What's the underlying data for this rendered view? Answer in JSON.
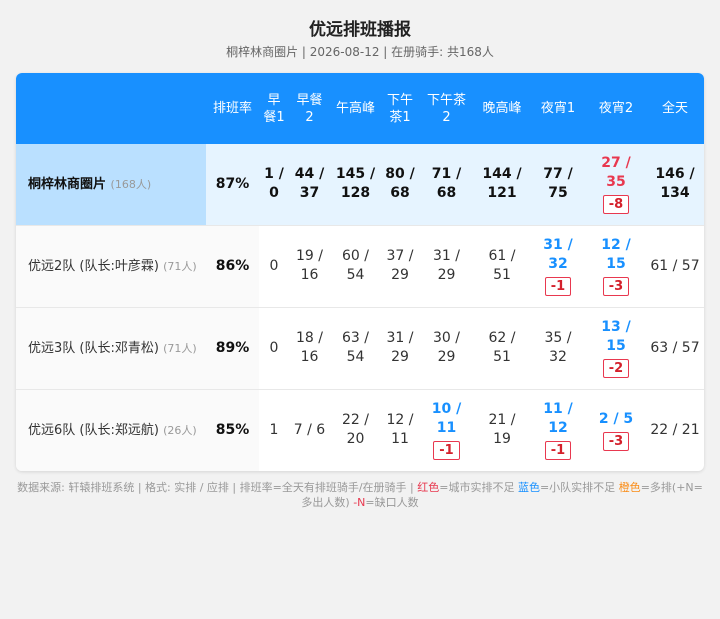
{
  "title": "优远排班播报",
  "subtitle": "桐梓林商圈片 | 2026-08-12 | 在册骑手: 共168人",
  "headers": [
    "",
    "排班率",
    "早餐1",
    "早餐2",
    "午高峰",
    "下午茶1",
    "下午茶2",
    "晚高峰",
    "夜宵1",
    "夜宵2",
    "全天"
  ],
  "rows": [
    {
      "name": "桐梓林商圈片",
      "count": "(168人)",
      "rate": "87%",
      "summary": true,
      "cells": [
        {
          "v": "1 / 0"
        },
        {
          "v": "44 / 37"
        },
        {
          "v": "145 / 128"
        },
        {
          "v": "80 / 68"
        },
        {
          "v": "71 / 68"
        },
        {
          "v": "144 / 121"
        },
        {
          "v": "77 / 75"
        },
        {
          "v": "27 / 35",
          "color": "red",
          "badge": "-8"
        },
        {
          "v": "146 / 134"
        }
      ]
    },
    {
      "name": "优远2队 (队长:叶彦霖)",
      "count": "(71人)",
      "rate": "86%",
      "cells": [
        {
          "v": "0"
        },
        {
          "v": "19 / 16"
        },
        {
          "v": "60 / 54"
        },
        {
          "v": "37 / 29"
        },
        {
          "v": "31 / 29"
        },
        {
          "v": "61 / 51"
        },
        {
          "v": "31 / 32",
          "color": "blue",
          "badge": "-1"
        },
        {
          "v": "12 / 15",
          "color": "blue",
          "badge": "-3"
        },
        {
          "v": "61 / 57"
        }
      ]
    },
    {
      "name": "优远3队 (队长:邓青松)",
      "count": "(71人)",
      "rate": "89%",
      "cells": [
        {
          "v": "0"
        },
        {
          "v": "18 / 16"
        },
        {
          "v": "63 / 54"
        },
        {
          "v": "31 / 29"
        },
        {
          "v": "30 / 29"
        },
        {
          "v": "62 / 51"
        },
        {
          "v": "35 / 32"
        },
        {
          "v": "13 / 15",
          "color": "blue",
          "badge": "-2"
        },
        {
          "v": "63 / 57"
        }
      ]
    },
    {
      "name": "优远6队 (队长:郑远航)",
      "count": "(26人)",
      "rate": "85%",
      "cells": [
        {
          "v": "1"
        },
        {
          "v": "7 / 6"
        },
        {
          "v": "22 / 20"
        },
        {
          "v": "12 / 11"
        },
        {
          "v": "10 / 11",
          "color": "blue",
          "badge": "-1"
        },
        {
          "v": "21 / 19"
        },
        {
          "v": "11 / 12",
          "color": "blue",
          "badge": "-1"
        },
        {
          "v": "2 / 5",
          "color": "blue",
          "badge": "-3"
        },
        {
          "v": "22 / 21"
        }
      ]
    }
  ],
  "footer": {
    "p1": "数据来源: 轩辕排班系统 | 格式: 实排 / 应排 | 排班率=全天有排班骑手/在册骑手 | ",
    "red": "红色",
    "p2": "=城市实排不足 ",
    "blue": "蓝色",
    "p3": "=小队实排不足 ",
    "orange": "橙色",
    "p4": "=多排(+N=多出人数) ",
    "n": "-N",
    "p5": "=缺口人数"
  },
  "colors": {
    "header_bg": "#1890ff",
    "red": "#e8384f",
    "blue": "#1890ff",
    "orange": "#fa8c16"
  }
}
